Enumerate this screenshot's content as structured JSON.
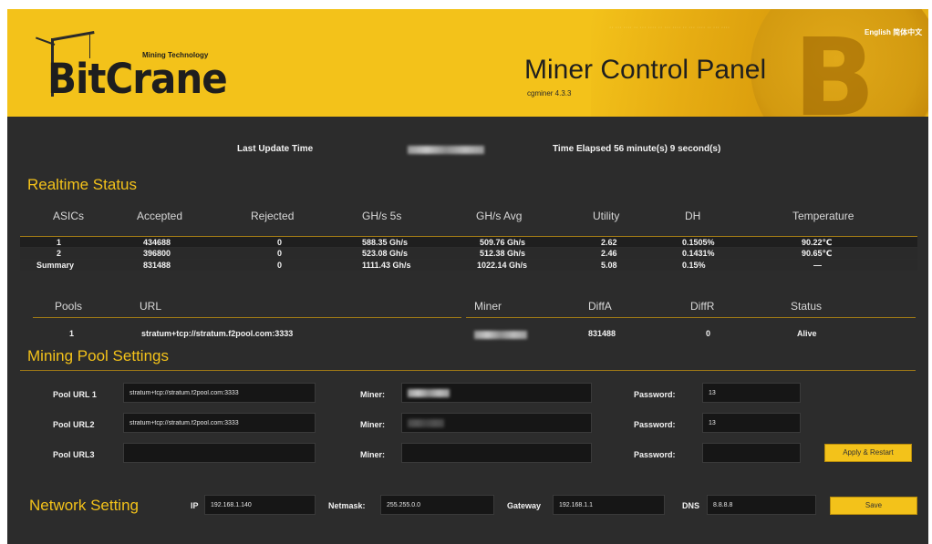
{
  "header": {
    "brand": "BitCrane",
    "tagline": "Mining Technology",
    "title": "Miner Control Panel",
    "version": "cgminer 4.3.3",
    "language_links": "English 简体中文"
  },
  "status_bar": {
    "last_update_label": "Last Update Time",
    "time_elapsed": "Time Elapsed 56 minute(s) 9 second(s)"
  },
  "realtime": {
    "title": "Realtime Status",
    "headers": [
      "ASICs",
      "Accepted",
      "Rejected",
      "GH/s 5s",
      "GH/s Avg",
      "Utility",
      "DH",
      "Temperature"
    ],
    "rows": [
      [
        "1",
        "434688",
        "0",
        "588.35 Gh/s",
        "509.76 Gh/s",
        "2.62",
        "0.1505%",
        "90.22℃"
      ],
      [
        "2",
        "396800",
        "0",
        "523.08 Gh/s",
        "512.38 Gh/s",
        "2.46",
        "0.1431%",
        "90.65℃"
      ],
      [
        "Summary",
        "831488",
        "0",
        "1111.43 Gh/s",
        "1022.14 Gh/s",
        "5.08",
        "0.15%",
        "—"
      ]
    ]
  },
  "pools": {
    "headers": [
      "Pools",
      "URL",
      "Miner",
      "DiffA",
      "DiffR",
      "Status"
    ],
    "rows": [
      [
        "1",
        "stratum+tcp://stratum.f2pool.com:3333",
        "",
        "831488",
        "0",
        "Alive"
      ]
    ]
  },
  "pool_settings": {
    "title": "Mining Pool Settings",
    "pool1": {
      "label": "Pool URL 1",
      "url": "stratum+tcp://stratum.f2pool.com:3333",
      "miner_label": "Miner:",
      "password_label": "Password:",
      "password": "13"
    },
    "pool2": {
      "label": "Pool URL2",
      "url": "stratum+tcp://stratum.f2pool.com:3333",
      "miner_label": "Miner:",
      "password_label": "Password:",
      "password": "13"
    },
    "pool3": {
      "label": "Pool URL3",
      "url": "",
      "miner_label": "Miner:",
      "password_label": "Password:",
      "password": ""
    },
    "apply_button": "Apply & Restart"
  },
  "network": {
    "title": "Network Setting",
    "ip_label": "IP",
    "ip": "192.168.1.140",
    "netmask_label": "Netmask:",
    "netmask": "255.255.0.0",
    "gateway_label": "Gateway",
    "gateway": "192.168.1.1",
    "dns_label": "DNS",
    "dns": "8.8.8.8",
    "save_button": "Save"
  },
  "colors": {
    "accent": "#f3c21a",
    "background": "#2c2c2c",
    "row_dark": "#1f1f1f"
  }
}
